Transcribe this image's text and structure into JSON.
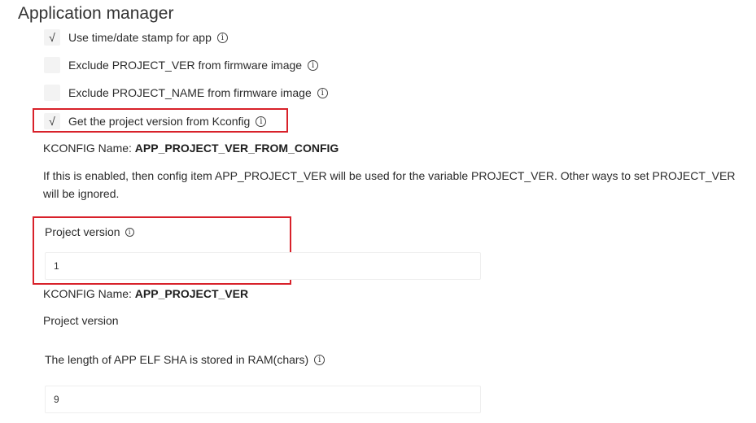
{
  "section_title": "Application manager",
  "options": [
    {
      "label": "Use time/date stamp for app",
      "checked": true
    },
    {
      "label": "Exclude PROJECT_VER from firmware image",
      "checked": false
    },
    {
      "label": "Exclude PROJECT_NAME from firmware image",
      "checked": false
    },
    {
      "label": "Get the project version from Kconfig",
      "checked": true
    }
  ],
  "check_glyph": "√",
  "info_glyph": "i",
  "kconfig_prefix": "KCONFIG Name:",
  "kconfig_1": "APP_PROJECT_VER_FROM_CONFIG",
  "description": "If this is enabled, then config item APP_PROJECT_VER will be used for the variable PROJECT_VER. Other ways to set PROJECT_VER will be ignored.",
  "project_version": {
    "label": "Project version",
    "value": "1"
  },
  "kconfig_2": "APP_PROJECT_VER",
  "project_version_help": "Project version",
  "elf_sha": {
    "label": "The length of APP ELF SHA is stored in RAM(chars)",
    "value": "9"
  },
  "colors": {
    "highlight": "#d8212a",
    "checkbox_bg": "#f3f3f3"
  },
  "icons": [
    "checkmark-icon",
    "info-icon"
  ]
}
